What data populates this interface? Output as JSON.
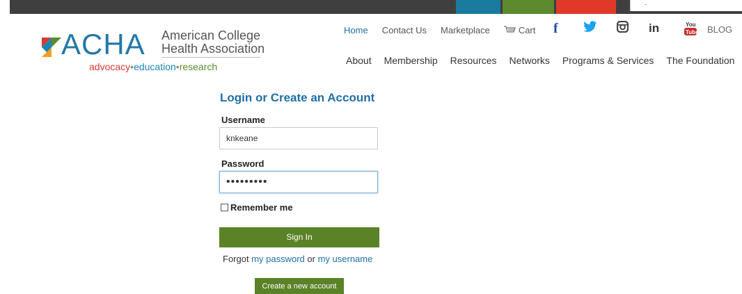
{
  "colors": {
    "brand_blue": "#1f6fa7",
    "button_green": "#5a8227",
    "top_bar": "#3f3f3f"
  },
  "topbar": {
    "search_placeholder": "-"
  },
  "logo": {
    "acronym": "ACHA",
    "name_line1": "American College",
    "name_line2": "Health Association",
    "tag_advocacy": "advocacy",
    "tag_education": "education",
    "tag_research": "research",
    "tag_separator": "•"
  },
  "utility_nav": {
    "home": "Home",
    "contact": "Contact Us",
    "marketplace": "Marketplace",
    "cart": "Cart",
    "social_icons": [
      "facebook-icon",
      "twitter-icon",
      "instagram-icon",
      "linkedin-icon",
      "youtube-icon"
    ],
    "facebook_glyph": "f",
    "linkedin_glyph": "in",
    "blog": "BLOG"
  },
  "main_nav": {
    "items": [
      "About",
      "Membership",
      "Resources",
      "Networks",
      "Programs & Services",
      "The Foundation"
    ]
  },
  "login": {
    "title": "Login or Create an Account",
    "username_label": "Username",
    "username_value": "knkeane",
    "password_label": "Password",
    "password_masked": "•••••••••",
    "remember_label": "Remember me",
    "sign_in": "Sign In",
    "forgot_prefix": "Forgot",
    "forgot_password": "my password",
    "forgot_or": "or",
    "forgot_username": "my username",
    "create_account": "Create a new account"
  }
}
